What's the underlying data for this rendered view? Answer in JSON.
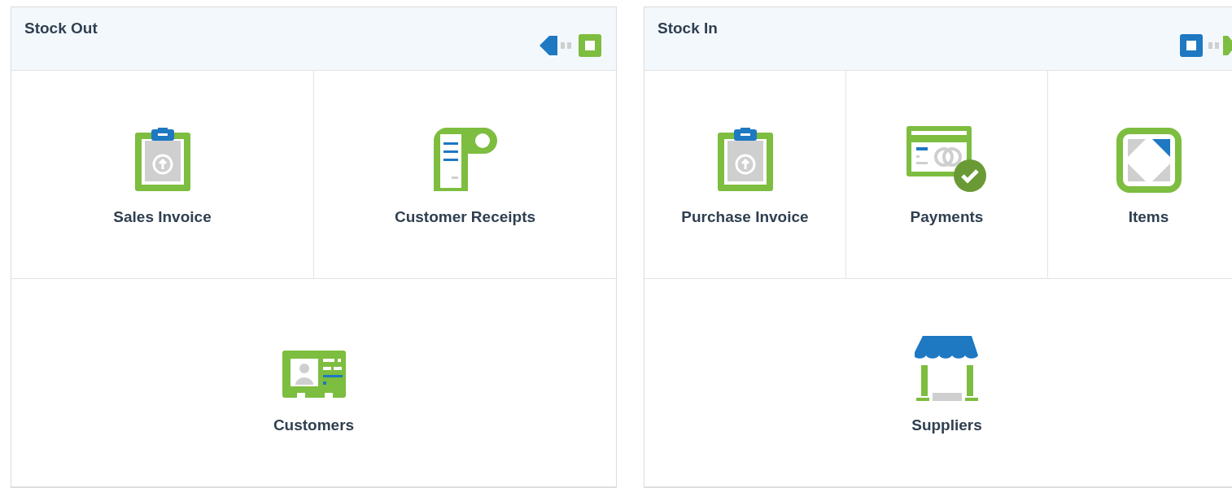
{
  "panels": [
    {
      "title": "Stock Out",
      "kind": "out",
      "shortcuts": [
        {
          "label": "Sales Invoice",
          "kind": "clipboard"
        },
        {
          "label": "Customer Receipts",
          "kind": "receipt"
        },
        {
          "label": "Customers",
          "kind": "idcard"
        }
      ]
    },
    {
      "title": "Stock In",
      "kind": "in",
      "shortcuts": [
        {
          "label": "Purchase Invoice",
          "kind": "clipboard"
        },
        {
          "label": "Payments",
          "kind": "payment"
        },
        {
          "label": "Items",
          "kind": "items"
        },
        {
          "label": "Suppliers",
          "kind": "shop"
        }
      ]
    }
  ]
}
